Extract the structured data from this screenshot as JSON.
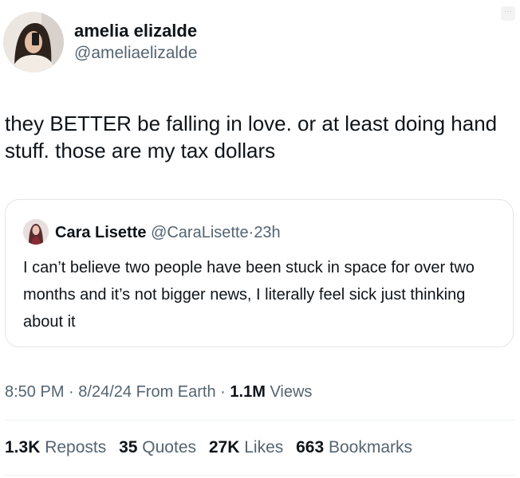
{
  "author": {
    "name": "amelia elizalde",
    "handle": "@ameliaelizalde"
  },
  "more_icon": "more-options-icon",
  "tweet": {
    "text": "they BETTER be falling in love. or at least doing hand stuff. those are my tax dollars"
  },
  "quote": {
    "name": "Cara Lisette",
    "handle": "@CaraLisette",
    "separator": "·",
    "time": "23h",
    "text": "I can’t believe two people have been stuck in space for over two months and it’s not bigger news, I literally feel sick just thinking about it"
  },
  "meta": {
    "time": "8:50 PM",
    "separator": "·",
    "date": "8/24/24",
    "source": "From Earth",
    "views_count": "1.1M",
    "views_label": "Views"
  },
  "stats": {
    "reposts_count": "1.3K",
    "reposts_label": "Reposts",
    "quotes_count": "35",
    "quotes_label": "Quotes",
    "likes_count": "27K",
    "likes_label": "Likes",
    "bookmarks_count": "663",
    "bookmarks_label": "Bookmarks"
  },
  "colors": {
    "text": "#0f1419",
    "secondary": "#536471",
    "border": "#e1e5e9"
  }
}
